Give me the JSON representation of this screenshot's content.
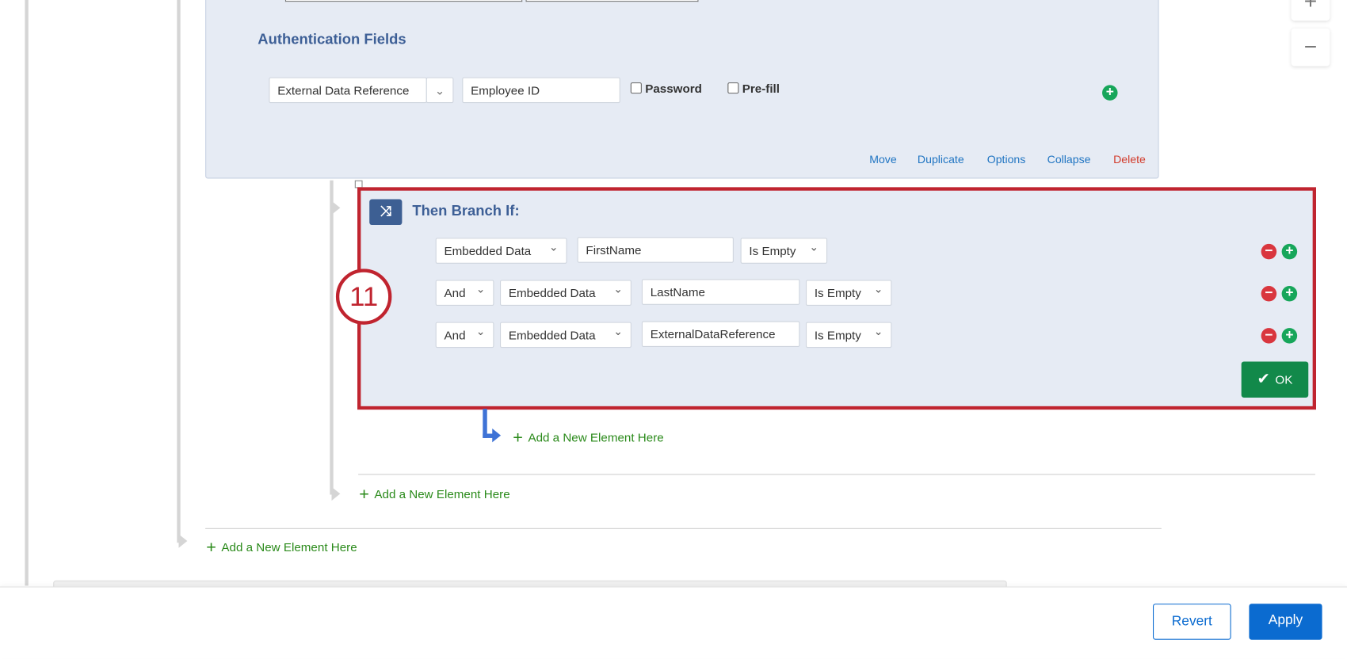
{
  "auth": {
    "title": "Authentication Fields",
    "field_type": "External Data Reference",
    "field_value": "Employee ID",
    "password_label": "Password",
    "prefill_label": "Pre-fill",
    "actions": {
      "move": "Move",
      "duplicate": "Duplicate",
      "options": "Options",
      "collapse": "Collapse",
      "delete": "Delete"
    }
  },
  "branch": {
    "title": "Then Branch If:",
    "step_badge": "11",
    "conditions": [
      {
        "conj": null,
        "source": "Embedded Data",
        "field": "FirstName",
        "operator": "Is Empty"
      },
      {
        "conj": "And",
        "source": "Embedded Data",
        "field": "LastName",
        "operator": "Is Empty"
      },
      {
        "conj": "And",
        "source": "Embedded Data",
        "field": "ExternalDataReference",
        "operator": "Is Empty"
      }
    ],
    "ok_label": "OK"
  },
  "add_element_label": "Add a New Element Here",
  "footer": {
    "revert": "Revert",
    "apply": "Apply"
  },
  "colors": {
    "accent": "#0b6bd0",
    "highlight": "#c0242f",
    "ok": "#12894a",
    "add": "#2a8a1a"
  }
}
